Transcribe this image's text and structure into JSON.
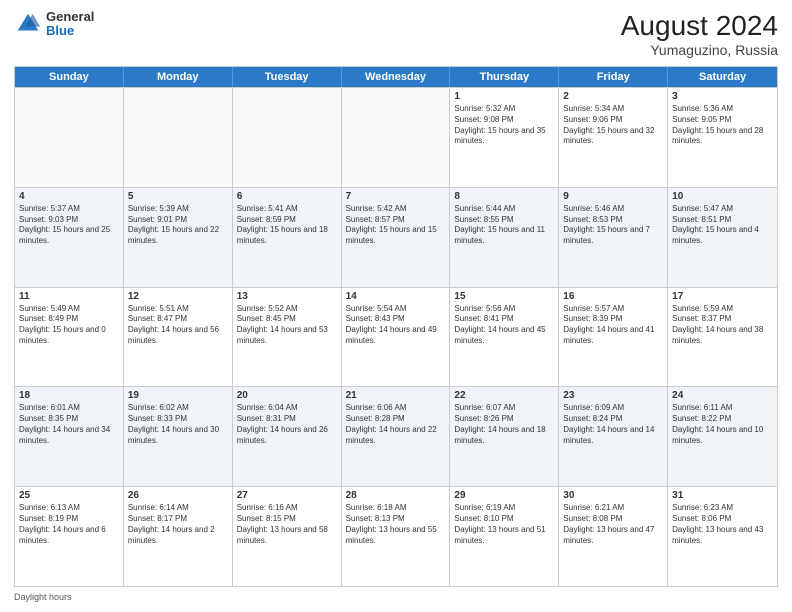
{
  "header": {
    "logo_general": "General",
    "logo_blue": "Blue",
    "month_year": "August 2024",
    "location": "Yumaguzino, Russia"
  },
  "days_of_week": [
    "Sunday",
    "Monday",
    "Tuesday",
    "Wednesday",
    "Thursday",
    "Friday",
    "Saturday"
  ],
  "footer_label": "Daylight hours",
  "weeks": [
    [
      {
        "day": "",
        "info": ""
      },
      {
        "day": "",
        "info": ""
      },
      {
        "day": "",
        "info": ""
      },
      {
        "day": "",
        "info": ""
      },
      {
        "day": "1",
        "info": "Sunrise: 5:32 AM\nSunset: 9:08 PM\nDaylight: 15 hours and 35 minutes."
      },
      {
        "day": "2",
        "info": "Sunrise: 5:34 AM\nSunset: 9:06 PM\nDaylight: 15 hours and 32 minutes."
      },
      {
        "day": "3",
        "info": "Sunrise: 5:36 AM\nSunset: 9:05 PM\nDaylight: 15 hours and 28 minutes."
      }
    ],
    [
      {
        "day": "4",
        "info": "Sunrise: 5:37 AM\nSunset: 9:03 PM\nDaylight: 15 hours and 25 minutes."
      },
      {
        "day": "5",
        "info": "Sunrise: 5:39 AM\nSunset: 9:01 PM\nDaylight: 15 hours and 22 minutes."
      },
      {
        "day": "6",
        "info": "Sunrise: 5:41 AM\nSunset: 8:59 PM\nDaylight: 15 hours and 18 minutes."
      },
      {
        "day": "7",
        "info": "Sunrise: 5:42 AM\nSunset: 8:57 PM\nDaylight: 15 hours and 15 minutes."
      },
      {
        "day": "8",
        "info": "Sunrise: 5:44 AM\nSunset: 8:55 PM\nDaylight: 15 hours and 11 minutes."
      },
      {
        "day": "9",
        "info": "Sunrise: 5:46 AM\nSunset: 8:53 PM\nDaylight: 15 hours and 7 minutes."
      },
      {
        "day": "10",
        "info": "Sunrise: 5:47 AM\nSunset: 8:51 PM\nDaylight: 15 hours and 4 minutes."
      }
    ],
    [
      {
        "day": "11",
        "info": "Sunrise: 5:49 AM\nSunset: 8:49 PM\nDaylight: 15 hours and 0 minutes."
      },
      {
        "day": "12",
        "info": "Sunrise: 5:51 AM\nSunset: 8:47 PM\nDaylight: 14 hours and 56 minutes."
      },
      {
        "day": "13",
        "info": "Sunrise: 5:52 AM\nSunset: 8:45 PM\nDaylight: 14 hours and 53 minutes."
      },
      {
        "day": "14",
        "info": "Sunrise: 5:54 AM\nSunset: 8:43 PM\nDaylight: 14 hours and 49 minutes."
      },
      {
        "day": "15",
        "info": "Sunrise: 5:56 AM\nSunset: 8:41 PM\nDaylight: 14 hours and 45 minutes."
      },
      {
        "day": "16",
        "info": "Sunrise: 5:57 AM\nSunset: 8:39 PM\nDaylight: 14 hours and 41 minutes."
      },
      {
        "day": "17",
        "info": "Sunrise: 5:59 AM\nSunset: 8:37 PM\nDaylight: 14 hours and 38 minutes."
      }
    ],
    [
      {
        "day": "18",
        "info": "Sunrise: 6:01 AM\nSunset: 8:35 PM\nDaylight: 14 hours and 34 minutes."
      },
      {
        "day": "19",
        "info": "Sunrise: 6:02 AM\nSunset: 8:33 PM\nDaylight: 14 hours and 30 minutes."
      },
      {
        "day": "20",
        "info": "Sunrise: 6:04 AM\nSunset: 8:31 PM\nDaylight: 14 hours and 26 minutes."
      },
      {
        "day": "21",
        "info": "Sunrise: 6:06 AM\nSunset: 8:28 PM\nDaylight: 14 hours and 22 minutes."
      },
      {
        "day": "22",
        "info": "Sunrise: 6:07 AM\nSunset: 8:26 PM\nDaylight: 14 hours and 18 minutes."
      },
      {
        "day": "23",
        "info": "Sunrise: 6:09 AM\nSunset: 8:24 PM\nDaylight: 14 hours and 14 minutes."
      },
      {
        "day": "24",
        "info": "Sunrise: 6:11 AM\nSunset: 8:22 PM\nDaylight: 14 hours and 10 minutes."
      }
    ],
    [
      {
        "day": "25",
        "info": "Sunrise: 6:13 AM\nSunset: 8:19 PM\nDaylight: 14 hours and 6 minutes."
      },
      {
        "day": "26",
        "info": "Sunrise: 6:14 AM\nSunset: 8:17 PM\nDaylight: 14 hours and 2 minutes."
      },
      {
        "day": "27",
        "info": "Sunrise: 6:16 AM\nSunset: 8:15 PM\nDaylight: 13 hours and 58 minutes."
      },
      {
        "day": "28",
        "info": "Sunrise: 6:18 AM\nSunset: 8:13 PM\nDaylight: 13 hours and 55 minutes."
      },
      {
        "day": "29",
        "info": "Sunrise: 6:19 AM\nSunset: 8:10 PM\nDaylight: 13 hours and 51 minutes."
      },
      {
        "day": "30",
        "info": "Sunrise: 6:21 AM\nSunset: 8:08 PM\nDaylight: 13 hours and 47 minutes."
      },
      {
        "day": "31",
        "info": "Sunrise: 6:23 AM\nSunset: 8:06 PM\nDaylight: 13 hours and 43 minutes."
      }
    ]
  ]
}
